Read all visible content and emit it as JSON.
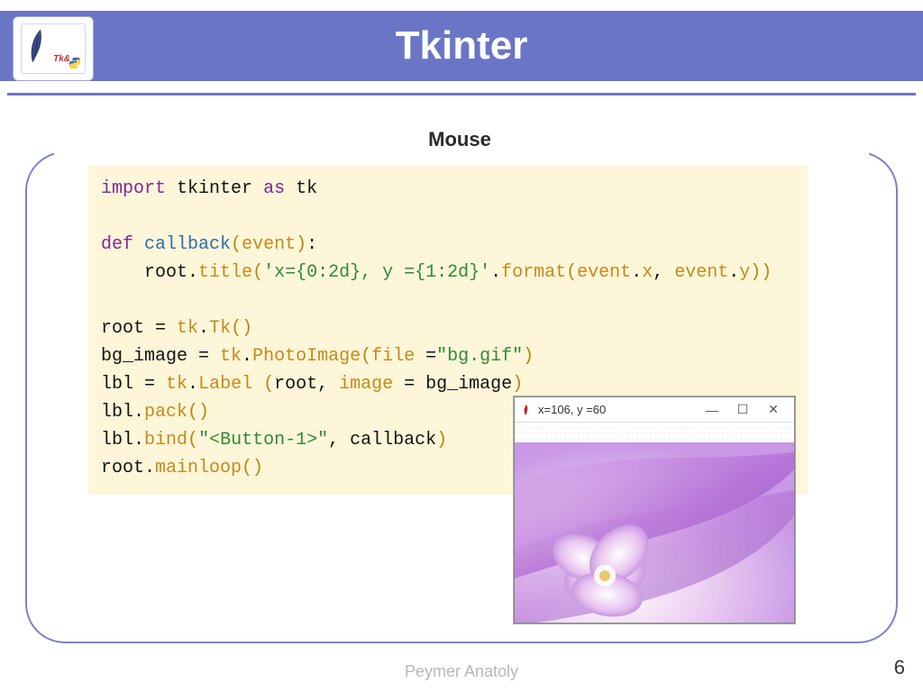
{
  "header": {
    "title": "Tkinter",
    "logo_label": "Tk&"
  },
  "subtitle": "Mouse",
  "code": {
    "import_kw": "import",
    "tkinter": "tkinter",
    "as_kw": "as",
    "tk_alias": "tk",
    "def_kw": "def",
    "callback_fn": "callback",
    "event_param": "event",
    "root": "root",
    "title_meth": "title",
    "fmt_str": "'x={0:2d}, y ={1:2d}'",
    "format_meth": "format",
    "event_x": "event",
    "x_attr": "x",
    "event_y": "event",
    "y_attr": "y",
    "Tk_class": "Tk",
    "bg_image": "bg_image",
    "PhotoImage": "PhotoImage",
    "file_kw": "file",
    "file_str": "\"bg.gif\"",
    "lbl": "lbl",
    "Label_class": "Label",
    "image_kw": "image",
    "pack_meth": "pack",
    "bind_meth": "bind",
    "btn_str": "\"<Button-1>\"",
    "callback_ref": "callback",
    "mainloop": "mainloop"
  },
  "result_window": {
    "title": "x=106, y =60",
    "minimize": "—",
    "maximize": "☐",
    "close": "✕"
  },
  "footer": {
    "author": "Peymer Anatoly",
    "page": "6"
  },
  "colors": {
    "accent": "#6a76c5"
  },
  "icons": {
    "feather": "feather-icon",
    "python": "python-icon",
    "tk_app": "tk-app-icon"
  }
}
